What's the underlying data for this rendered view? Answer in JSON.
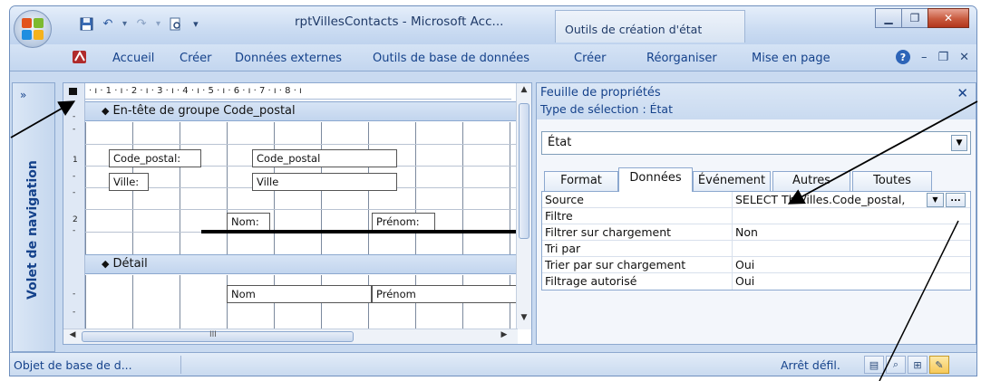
{
  "titlebar": {
    "app_title": "rptVillesContacts - Microsoft Acc...",
    "context_tab": "Outils de création d'état"
  },
  "ribbon": {
    "tabs": [
      "Accueil",
      "Créer",
      "Données externes",
      "Outils de base de données",
      "Créer",
      "Réorganiser",
      "Mise en page"
    ],
    "help_glyph": "?"
  },
  "nav_pane": {
    "toggle": "»",
    "label": "Volet de navigation"
  },
  "designer": {
    "hruler": "· ı · 1 · ı · 2 · ı · 3 · ı · 4 · ı · 5 · ı · 6 · ı · 7 · ı · 8 · ı",
    "vruler_ticks": [
      "1",
      "2"
    ],
    "group_header": "En-tête de groupe Code_postal",
    "detail_header": "Détail",
    "controls": {
      "lbl_code_postal": "Code_postal:",
      "txt_code_postal": "Code_postal",
      "lbl_ville": "Ville:",
      "txt_ville": "Ville",
      "lbl_nom": "Nom:",
      "lbl_prenom": "Prénom:",
      "txt_nom": "Nom",
      "txt_prenom": "Prénom"
    },
    "hscroll_marker": "III"
  },
  "property_sheet": {
    "title": "Feuille de propriétés",
    "selection_type": "Type de sélection :  État",
    "combo_value": "État",
    "tabs": [
      "Format",
      "Données",
      "Événement",
      "Autres",
      "Toutes"
    ],
    "active_tab": "Données",
    "rows": [
      {
        "name": "Source",
        "value": "SELECT TblVilles.Code_postal,"
      },
      {
        "name": "Filtre",
        "value": ""
      },
      {
        "name": "Filtrer sur chargement",
        "value": "Non"
      },
      {
        "name": "Tri par",
        "value": ""
      },
      {
        "name": "Trier par sur chargement",
        "value": "Oui"
      },
      {
        "name": "Filtrage autorisé",
        "value": "Oui"
      }
    ],
    "build_button": "..."
  },
  "statusbar": {
    "left": "Objet de base de d...",
    "right": "Arrêt défil."
  },
  "colors": {
    "accent": "#15428b",
    "frame": "#c9daf0",
    "close": "#c85a3e"
  }
}
